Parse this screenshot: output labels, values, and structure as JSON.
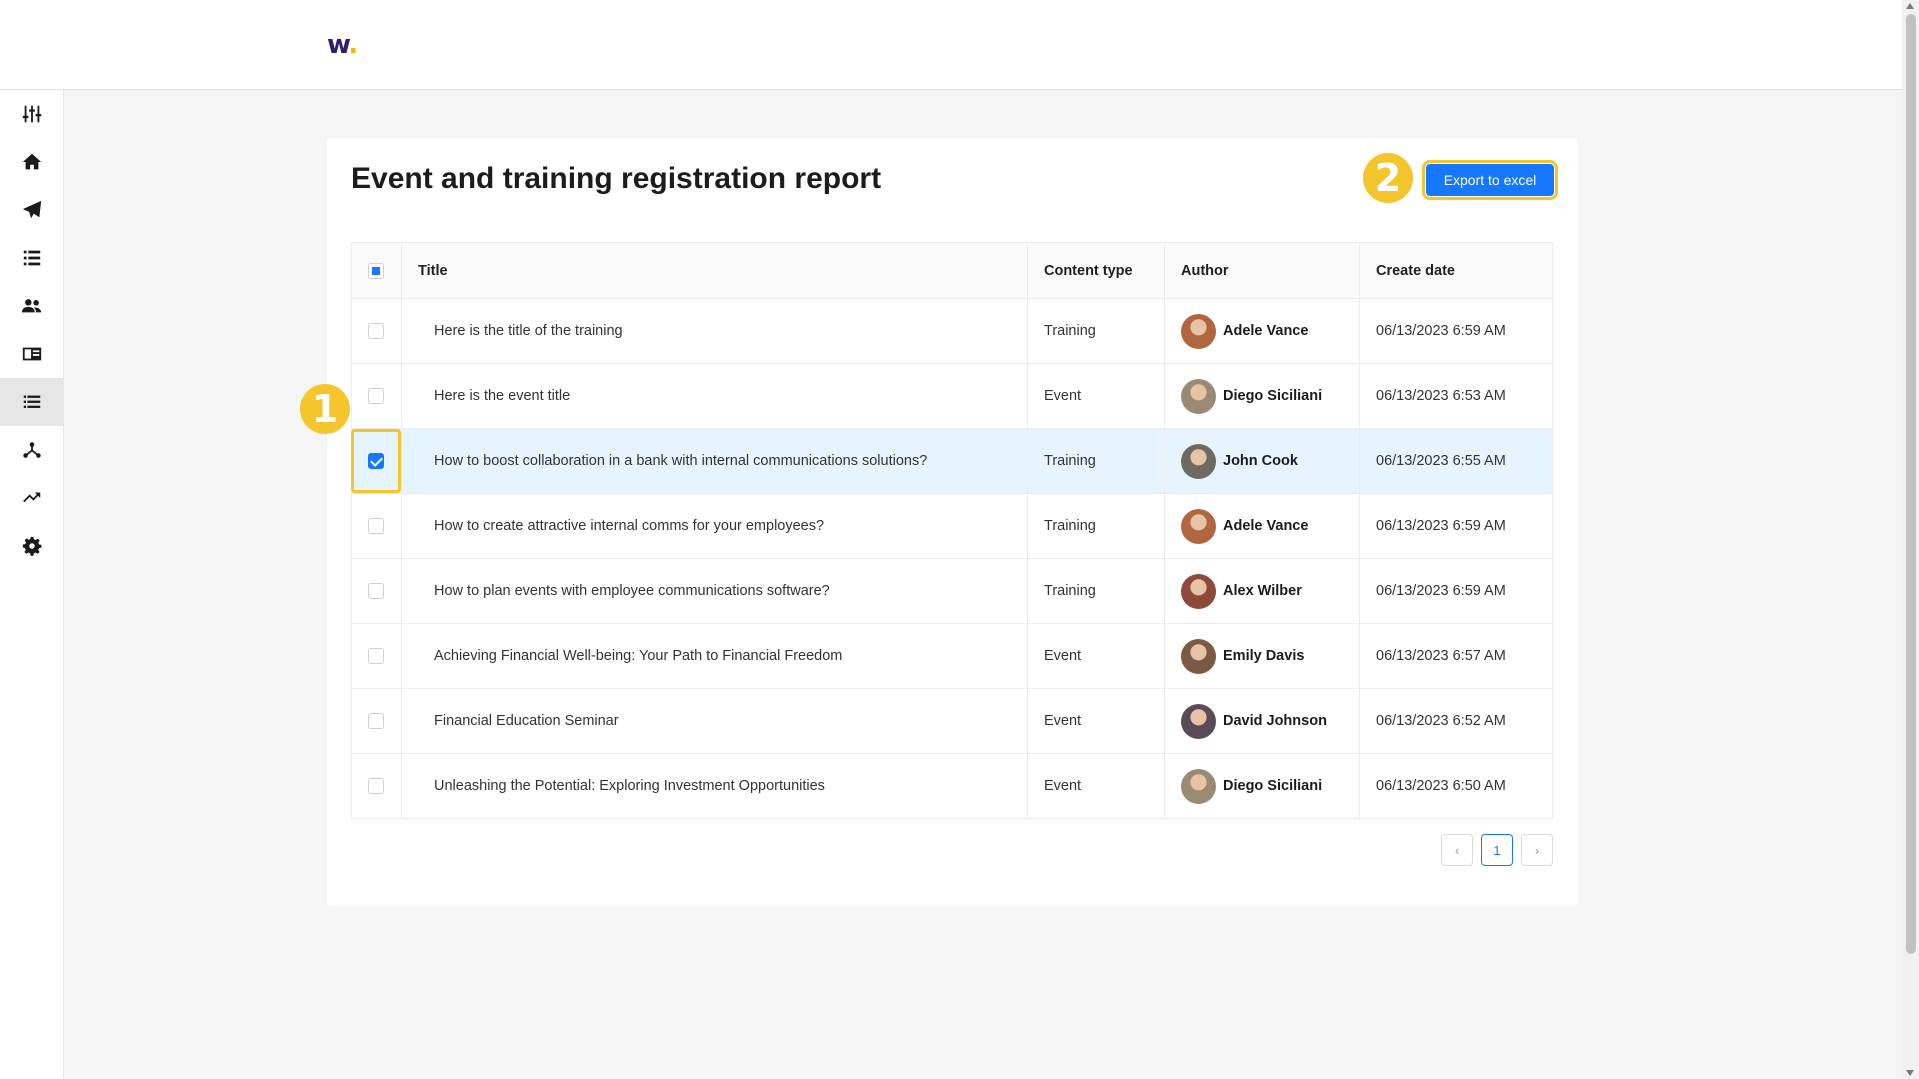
{
  "brand": {
    "logo_text": "w",
    "logo_dot": ".",
    "accent": "#1677ff",
    "highlight": "#f5c52e"
  },
  "sidebar": {
    "items": [
      {
        "name": "sliders-icon",
        "active": false
      },
      {
        "name": "home-icon",
        "active": false
      },
      {
        "name": "paper-plane-icon",
        "active": false
      },
      {
        "name": "list-bullets-icon",
        "active": false
      },
      {
        "name": "users-icon",
        "active": false
      },
      {
        "name": "newspaper-icon",
        "active": false
      },
      {
        "name": "list-icon",
        "active": true
      },
      {
        "name": "hierarchy-icon",
        "active": false
      },
      {
        "name": "trending-up-icon",
        "active": false
      },
      {
        "name": "gear-icon",
        "active": false
      }
    ]
  },
  "page": {
    "title": "Event and training registration report"
  },
  "toolbar": {
    "export_label": "Export to excel"
  },
  "badges": {
    "step1": "1",
    "step2": "2"
  },
  "table": {
    "columns": [
      "Title",
      "Content type",
      "Author",
      "Create date"
    ],
    "rows": [
      {
        "title": "Here is the title of the training",
        "type": "Training",
        "author": "Adele Vance",
        "date": "06/13/2023 6:59 AM",
        "checked": false,
        "avatar_color": "#b0673f"
      },
      {
        "title": "Here is the event title",
        "type": "Event",
        "author": "Diego Siciliani",
        "date": "06/13/2023 6:53 AM",
        "checked": false,
        "avatar_color": "#9a8a72"
      },
      {
        "title": "How to boost collaboration in a bank with internal communications solutions?",
        "type": "Training",
        "author": "John Cook",
        "date": "06/13/2023 6:55 AM",
        "checked": true,
        "avatar_color": "#6d6a62"
      },
      {
        "title": "How to create attractive internal comms for your employees?",
        "type": "Training",
        "author": "Adele Vance",
        "date": "06/13/2023 6:59 AM",
        "checked": false,
        "avatar_color": "#b0673f"
      },
      {
        "title": "How to plan events with employee communications software?",
        "type": "Training",
        "author": "Alex Wilber",
        "date": "06/13/2023 6:59 AM",
        "checked": false,
        "avatar_color": "#8c4a3a"
      },
      {
        "title": "Achieving Financial Well-being: Your Path to Financial Freedom",
        "type": "Event",
        "author": "Emily Davis",
        "date": "06/13/2023 6:57 AM",
        "checked": false,
        "avatar_color": "#7a5a43"
      },
      {
        "title": "Financial Education Seminar",
        "type": "Event",
        "author": "David Johnson",
        "date": "06/13/2023 6:52 AM",
        "checked": false,
        "avatar_color": "#5b4b58"
      },
      {
        "title": "Unleashing the Potential: Exploring Investment Opportunities",
        "type": "Event",
        "author": "Diego Siciliani",
        "date": "06/13/2023 6:50 AM",
        "checked": false,
        "avatar_color": "#9a8a72"
      }
    ]
  },
  "pagination": {
    "current": "1",
    "prev_icon": "chevron-left-icon",
    "next_icon": "chevron-right-icon"
  }
}
